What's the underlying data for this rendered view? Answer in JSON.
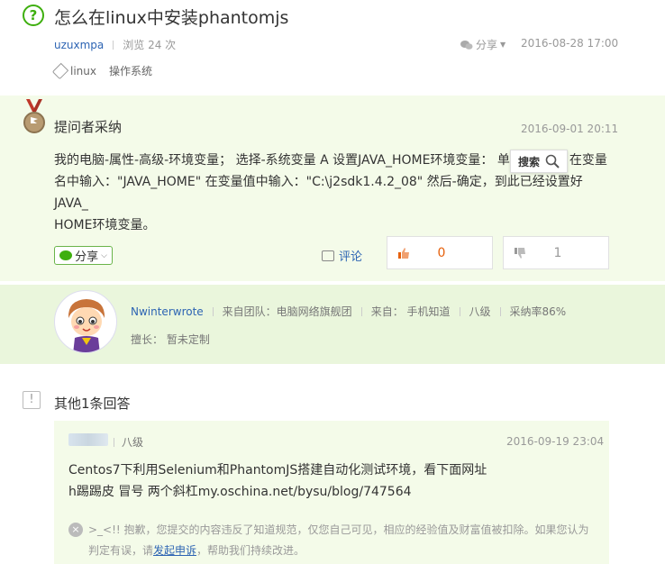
{
  "question": {
    "icon": "?",
    "title": "怎么在linux中安装phantomjs",
    "user": "uzuxmpa",
    "views": "浏览 24 次",
    "share": "分享",
    "date": "2016-08-28 17:00",
    "tags": [
      "linux",
      "操作系统"
    ]
  },
  "accepted": {
    "title": "提问者采纳",
    "date": "2016-09-01 20:11",
    "text_line1": "我的电脑-属性-高级-环境变量； 选择-系统变量 A 设置JAVA_HOME环境变量： 单",
    "text_line1_tail": "在变量",
    "text_line2": "名中输入：\"JAVA_HOME\" 在变量值中输入：\"C:\\j2sdk1.4.2_08\" 然后-确定，到此已经设置好JAVA_",
    "text_line3": "HOME环境变量。",
    "search_popup": "搜索",
    "share_label": "分享",
    "comment_label": "评论",
    "up_count": "0",
    "down_count": "1"
  },
  "answerer": {
    "name": "Nwinterwrote",
    "team": "来自团队：电脑网络旗舰团",
    "source": "来自：  手机知道",
    "level": "八级",
    "rate": "采纳率86%",
    "specialty": "擅长：  暂未定制"
  },
  "others": {
    "icon": "!",
    "title": "其他1条回答",
    "level": "八级",
    "date": "2016-09-19 23:04",
    "line1": "Centos7下利用Selenium和PhantomJS搭建自动化测试环境，看下面网址",
    "line2": "h踢踢皮 冒号 两个斜杠my.oschina.net/bysu/blog/747564",
    "notice_icon": "×",
    "notice_pre": ">_<!! 抱歉，您提交的内容违反了知道规范，仅您自己可见，相应的经验值及财富值被扣除。如果您认为判定有误，请",
    "notice_link": "发起申诉",
    "notice_post": "，帮助我们持续改进。"
  },
  "colors": {
    "green": "#3eaf0e",
    "link": "#2d64b3",
    "panel_bg": "#f4fbe9",
    "orange": "#e6600c"
  }
}
